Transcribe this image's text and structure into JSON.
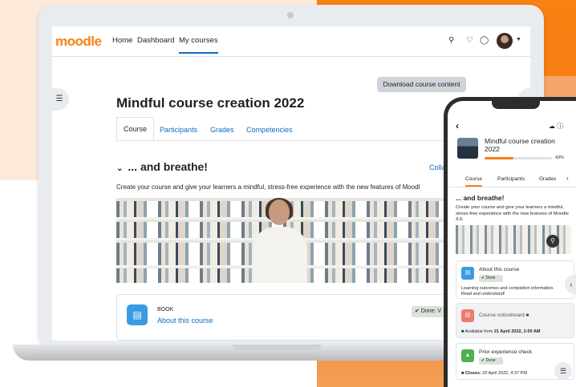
{
  "nav": {
    "logo": "moodle",
    "links": [
      "Home",
      "Dashboard",
      "My courses"
    ],
    "icons": [
      "search-icon",
      "bell-icon",
      "chat-icon"
    ]
  },
  "course": {
    "download_label": "Download course content",
    "title": "Mindful course creation 2022",
    "tabs": [
      "Course",
      "Participants",
      "Grades",
      "Competencies"
    ],
    "section_title": "... and breathe!",
    "collapse_label": "Colla",
    "description": "Create your course and give your learners a mindful, stress-free experience with the new features of Moodl",
    "activity": {
      "type": "BOOK",
      "name": "About this course",
      "status": "Done: V"
    }
  },
  "phone": {
    "title": "Mindful course creation 2022",
    "progress_pct": 43,
    "progress_label": "43%",
    "tabs": [
      "Course",
      "Participants",
      "Grades"
    ],
    "section_title": "... and breathe!",
    "description": "Create your course and give your learners a mindful, stress-free experience with the new features of Moodle 4.0.",
    "cards": [
      {
        "name": "About this course",
        "status": "Done",
        "note": "Learning outcomes and completion information. Read and understand!"
      },
      {
        "name": "Course noticeboard",
        "note_prefix": "Available from ",
        "note_bold": "21 April 2022, 2:00 AM"
      },
      {
        "name": "Prior experience check",
        "status": "Done",
        "note_bold": "Closes:",
        "note_rest": " 20 April 2022, 4:37 PM"
      }
    ]
  },
  "colors": {
    "brand": "#f98012",
    "link": "#0f6cbf",
    "done": "#d7e4d6"
  }
}
